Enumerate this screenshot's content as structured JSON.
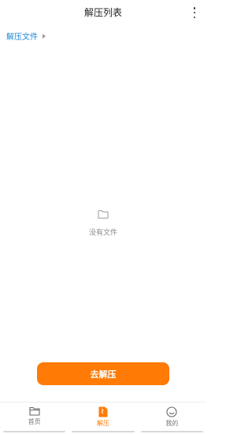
{
  "header": {
    "title": "解压列表",
    "more_icon": "more-vertical-icon"
  },
  "breadcrumb": {
    "label": "解压文件",
    "arrow_icon": "caret-right-icon"
  },
  "empty_state": {
    "icon": "folder-outline-icon",
    "text": "没有文件"
  },
  "primary_action": {
    "label": "去解压"
  },
  "tabbar": {
    "items": [
      {
        "label": "首页",
        "icon": "folder-icon",
        "active": false
      },
      {
        "label": "解压",
        "icon": "zip-file-icon",
        "active": true
      },
      {
        "label": "我的",
        "icon": "smiley-face-icon",
        "active": false
      }
    ]
  },
  "colors": {
    "accent": "#ff7b06",
    "link": "#1f8ad8",
    "muted_text": "#8a8a8a"
  }
}
